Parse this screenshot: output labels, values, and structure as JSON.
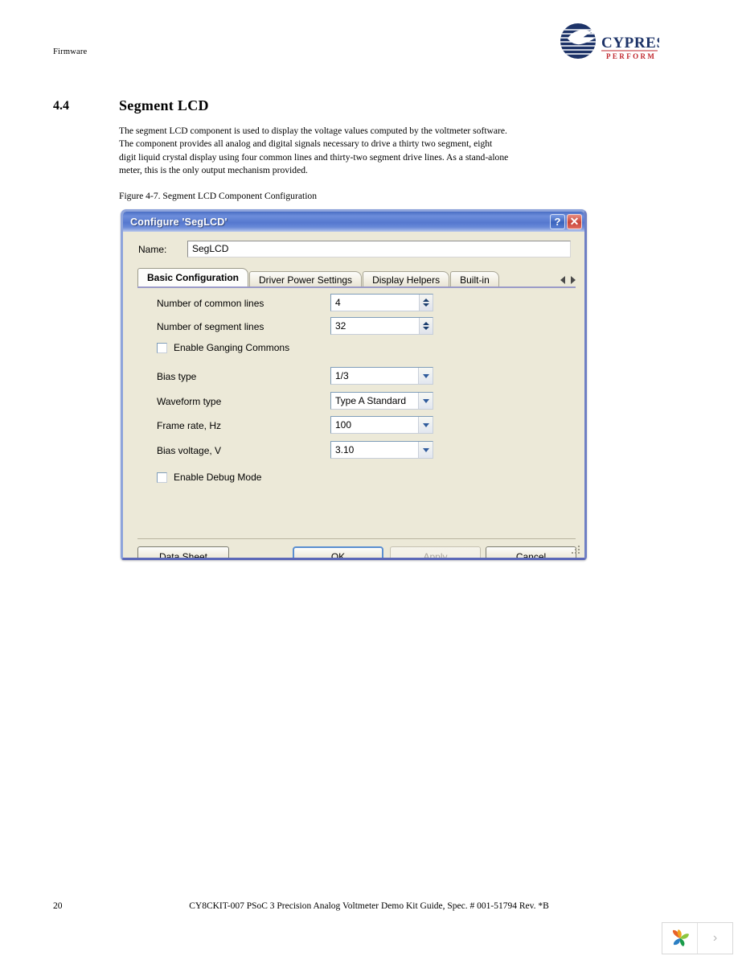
{
  "page": {
    "running_head": "Firmware",
    "section_number": "4.4",
    "section_title": "Segment LCD",
    "paragraph": "The segment LCD component is used to display the voltage values computed by the voltmeter software. The component provides all analog and digital signals necessary to drive a thirty two segment, eight digit liquid crystal display using four common lines and thirty-two segment drive lines. As a stand-alone meter, this is the only output mechanism provided.",
    "figure_caption": "Figure 4-7.  Segment LCD Component Configuration",
    "page_number": "20",
    "footer": "CY8CKIT-007 PSoC 3 Precision Analog Voltmeter Demo Kit Guide, Spec. # 001-51794 Rev. *B"
  },
  "logo": {
    "wordmark": "CYPRESS",
    "tagline": "PERFORM",
    "brand_color": "#1d3368",
    "tagline_color": "#c0272d"
  },
  "viewer": {
    "next_glyph": "›"
  },
  "dialog": {
    "title": "Configure 'SegLCD'",
    "help_glyph": "?",
    "close_glyph": "✕",
    "title_gradient_start": "#4a6ec4",
    "title_gradient_end": "#b9c8ec",
    "name": {
      "label": "Name:",
      "value": "SegLCD",
      "placeholder": ""
    },
    "tabs": [
      {
        "label": "Basic Configuration",
        "active": true
      },
      {
        "label": "Driver Power Settings",
        "active": false
      },
      {
        "label": "Display Helpers",
        "active": false
      },
      {
        "label": "Built-in",
        "active": false
      }
    ],
    "fields": [
      {
        "label": "Number of common lines",
        "value": "4",
        "type": "spinner"
      },
      {
        "label": "Number of segment lines",
        "value": "32",
        "type": "spinner"
      },
      {
        "label": "Bias type",
        "value": "1/3",
        "type": "combo"
      },
      {
        "label": "Waveform type",
        "value": "Type A Standard",
        "type": "combo"
      },
      {
        "label": "Frame rate, Hz",
        "value": "100",
        "type": "combo"
      },
      {
        "label": "Bias voltage, V",
        "value": "3.10",
        "type": "combo"
      }
    ],
    "checkboxes": [
      {
        "label": "Enable Ganging Commons",
        "checked": false
      },
      {
        "label": "Enable Debug Mode",
        "checked": false
      }
    ],
    "buttons": [
      {
        "label": "Data Sheet",
        "state": "normal"
      },
      {
        "label": "OK",
        "state": "default"
      },
      {
        "label": "Apply",
        "state": "disabled"
      },
      {
        "label": "Cancel",
        "state": "normal"
      }
    ]
  }
}
